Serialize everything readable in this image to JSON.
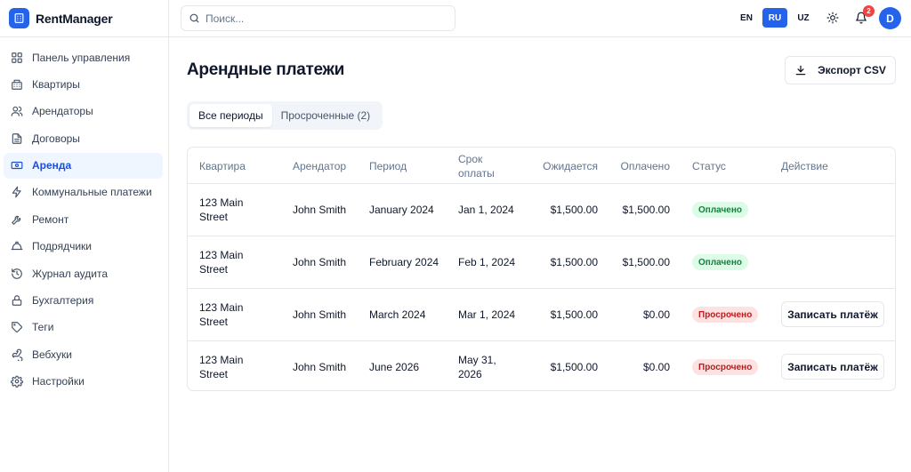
{
  "app": {
    "name": "RentManager"
  },
  "colors": {
    "accent": "#2563eb",
    "paid_bg": "#dcfce7",
    "overdue_bg": "#fee2e2",
    "badge": "#ef4444"
  },
  "sidebar": {
    "items": [
      {
        "label": "Панель управления",
        "icon": "dashboard-icon"
      },
      {
        "label": "Квартиры",
        "icon": "building-icon"
      },
      {
        "label": "Арендаторы",
        "icon": "users-icon"
      },
      {
        "label": "Договоры",
        "icon": "document-icon"
      },
      {
        "label": "Аренда",
        "icon": "banknote-icon",
        "active": true
      },
      {
        "label": "Коммунальные платежи",
        "icon": "zap-icon"
      },
      {
        "label": "Ремонт",
        "icon": "wrench-icon"
      },
      {
        "label": "Подрядчики",
        "icon": "hard-hat-icon"
      },
      {
        "label": "Журнал аудита",
        "icon": "history-icon"
      },
      {
        "label": "Бухгалтерия",
        "icon": "lock-icon"
      },
      {
        "label": "Теги",
        "icon": "tag-icon"
      },
      {
        "label": "Вебхуки",
        "icon": "webhook-icon"
      },
      {
        "label": "Настройки",
        "icon": "gear-icon"
      }
    ]
  },
  "topbar": {
    "search_placeholder": "Поиск...",
    "languages": [
      "EN",
      "RU",
      "UZ"
    ],
    "active_language": "RU",
    "notifications_count": "2",
    "avatar_initial": "D"
  },
  "page": {
    "title": "Арендные платежи",
    "export_label": "Экспорт CSV",
    "tabs": [
      {
        "label": "Все периоды",
        "active": true
      },
      {
        "label": "Просроченные (2)",
        "active": false
      }
    ]
  },
  "table": {
    "headers": [
      "Квартира",
      "Арендатор",
      "Период",
      "Срок оплаты",
      "Ожидается",
      "Оплачено",
      "Статус",
      "Действие"
    ],
    "rows": [
      {
        "apartment": "123 Main Street",
        "tenant": "John Smith",
        "period": "January 2024",
        "due": "Jan 1, 2024",
        "expected": "$1,500.00",
        "paid": "$1,500.00",
        "status": "Оплачено",
        "status_type": "paid",
        "action": ""
      },
      {
        "apartment": "123 Main Street",
        "tenant": "John Smith",
        "period": "February 2024",
        "due": "Feb 1, 2024",
        "expected": "$1,500.00",
        "paid": "$1,500.00",
        "status": "Оплачено",
        "status_type": "paid",
        "action": ""
      },
      {
        "apartment": "123 Main Street",
        "tenant": "John Smith",
        "period": "March 2024",
        "due": "Mar 1, 2024",
        "expected": "$1,500.00",
        "paid": "$0.00",
        "status": "Просрочено",
        "status_type": "overdue",
        "action": "Записать платёж"
      },
      {
        "apartment": "123 Main Street",
        "tenant": "John Smith",
        "period": "June 2026",
        "due": "May 31, 2026",
        "expected": "$1,500.00",
        "paid": "$0.00",
        "status": "Просрочено",
        "status_type": "overdue",
        "action": "Записать платёж"
      }
    ]
  }
}
